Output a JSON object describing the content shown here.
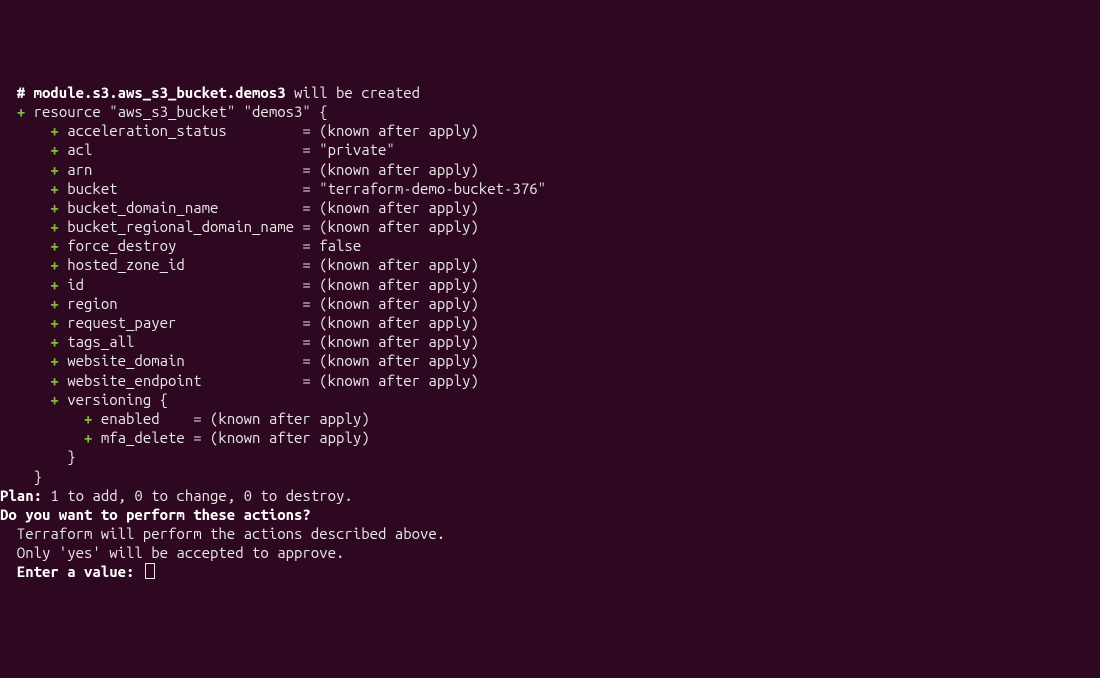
{
  "header": {
    "hash": "#",
    "module_path": "module.s3.aws_s3_bucket.demos3",
    "suffix": " will be created"
  },
  "resource_line": {
    "plus": "+",
    "text": "resource \"aws_s3_bucket\" \"demos3\" {"
  },
  "attrs": [
    {
      "key": "acceleration_status",
      "pad": "        ",
      "value": "(known after apply)"
    },
    {
      "key": "acl",
      "pad": "                        ",
      "value": "\"private\""
    },
    {
      "key": "arn",
      "pad": "                        ",
      "value": "(known after apply)"
    },
    {
      "key": "bucket",
      "pad": "                     ",
      "value": "\"terraform-demo-bucket-376\""
    },
    {
      "key": "bucket_domain_name",
      "pad": "         ",
      "value": "(known after apply)"
    },
    {
      "key": "bucket_regional_domain_name",
      "pad": "",
      "value": "(known after apply)"
    },
    {
      "key": "force_destroy",
      "pad": "              ",
      "value": "false"
    },
    {
      "key": "hosted_zone_id",
      "pad": "             ",
      "value": "(known after apply)"
    },
    {
      "key": "id",
      "pad": "                         ",
      "value": "(known after apply)"
    },
    {
      "key": "region",
      "pad": "                     ",
      "value": "(known after apply)"
    },
    {
      "key": "request_payer",
      "pad": "              ",
      "value": "(known after apply)"
    },
    {
      "key": "tags_all",
      "pad": "                   ",
      "value": "(known after apply)"
    },
    {
      "key": "website_domain",
      "pad": "             ",
      "value": "(known after apply)"
    },
    {
      "key": "website_endpoint",
      "pad": "           ",
      "value": "(known after apply)"
    }
  ],
  "versioning": {
    "open": "versioning {",
    "items": [
      {
        "key": "enabled",
        "pad": "   ",
        "value": "(known after apply)"
      },
      {
        "key": "mfa_delete",
        "pad": "",
        "value": "(known after apply)"
      }
    ],
    "close": "}"
  },
  "close_resource": "}",
  "plan": {
    "label": "Plan:",
    "text": " 1 to add, 0 to change, 0 to destroy."
  },
  "confirm": {
    "question": "Do you want to perform these actions?",
    "line1": "  Terraform will perform the actions described above.",
    "line2": "  Only 'yes' will be accepted to approve.",
    "prompt": "  Enter a value: "
  }
}
